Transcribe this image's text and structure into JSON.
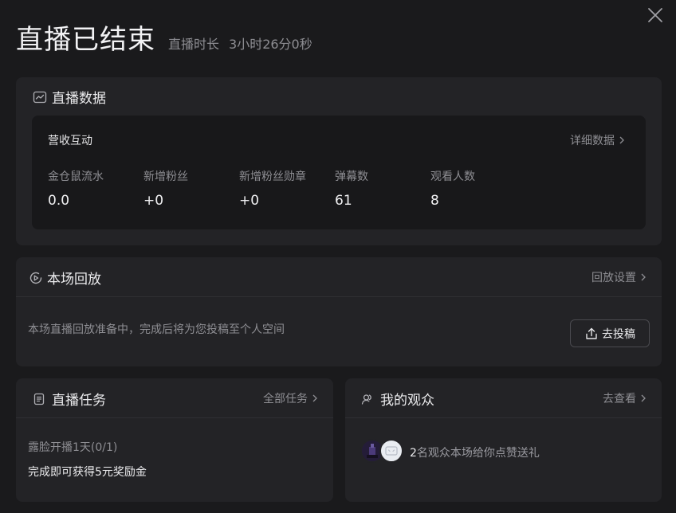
{
  "header": {
    "title": "直播已结束",
    "duration_label": "直播时长",
    "duration_value": "3小时26分0秒"
  },
  "data_card": {
    "title": "直播数据",
    "inner_title": "营收互动",
    "detail_link": "详细数据",
    "stats": [
      {
        "label": "金仓鼠流水",
        "value": "0.0"
      },
      {
        "label": "新增粉丝",
        "value": "+0"
      },
      {
        "label": "新增粉丝勋章",
        "value": "+0"
      },
      {
        "label": "弹幕数",
        "value": "61"
      },
      {
        "label": "观看人数",
        "value": "8"
      }
    ]
  },
  "replay_card": {
    "title": "本场回放",
    "settings_link": "回放设置",
    "description": "本场直播回放准备中，完成后将为您投稿至个人空间",
    "upload_button": "去投稿"
  },
  "task_card": {
    "title": "直播任务",
    "all_link": "全部任务",
    "task_name": "露脸开播1天(0/1)",
    "task_reward": "完成即可获得5元奖励金"
  },
  "audience_card": {
    "title": "我的观众",
    "view_link": "去查看",
    "count": "2",
    "text": "名观众本场给你点赞送礼"
  },
  "icons": {
    "close": "close-icon",
    "data": "trend-chart-icon",
    "replay": "play-circle-icon",
    "upload": "upload-icon",
    "task": "document-icon",
    "audience": "users-icon"
  },
  "colors": {
    "background": "#1a1a1c",
    "card": "#232326",
    "inner_panel": "#18181a",
    "muted_text": "#8e8e93"
  }
}
